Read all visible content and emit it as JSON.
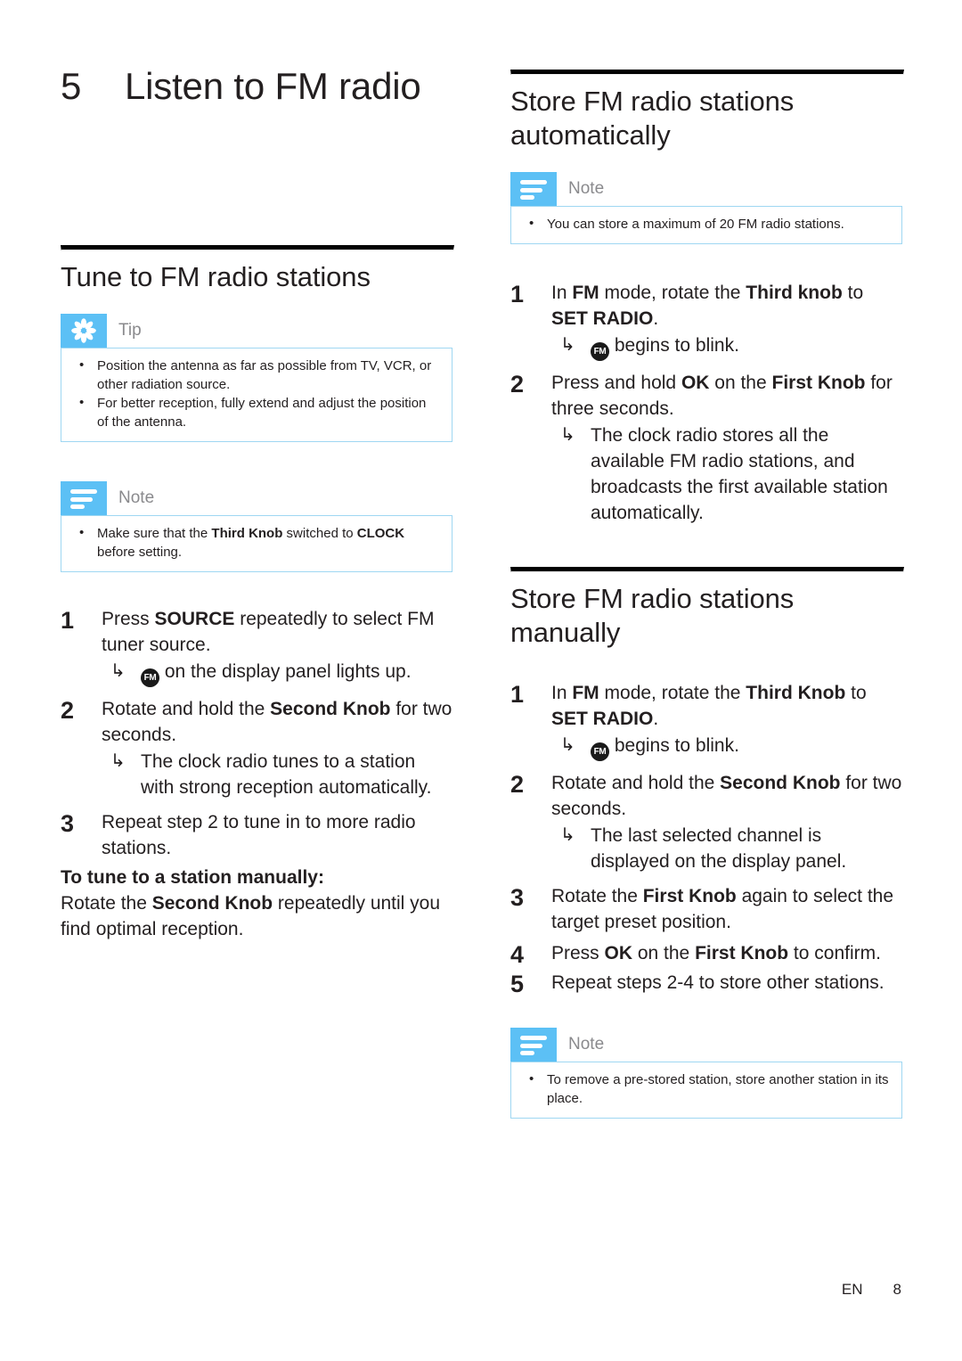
{
  "chapter": {
    "number": "5",
    "title": "Listen to FM radio"
  },
  "left_column": {
    "section_heading": "Tune to FM radio stations",
    "tip": {
      "icon": "asterisk-icon",
      "label": "Tip",
      "bullets": [
        "Position the antenna as far as possible from TV, VCR, or other radiation source.",
        "For better reception, fully extend and adjust the position of the antenna."
      ]
    },
    "note": {
      "icon": "note-lines-icon",
      "label": "Note",
      "bullet_parts": [
        "Make sure that the ",
        "Third Knob",
        " switched to ",
        "CLOCK",
        " before setting."
      ]
    },
    "steps": [
      {
        "num": "1",
        "text_parts": [
          "Press ",
          "SOURCE",
          " repeatedly to select FM tuner source."
        ],
        "substep": {
          "arrow": "↳",
          "icon": "fm-badge-icon",
          "icon_text": "FM",
          "text": " on the display panel lights up."
        }
      },
      {
        "num": "2",
        "text_parts": [
          "Rotate and hold the ",
          "Second Knob",
          " for two seconds."
        ],
        "substep": {
          "arrow": "↳",
          "text": "The clock radio tunes to a station with strong reception automatically."
        }
      },
      {
        "num": "3",
        "text_parts": [
          "Repeat step 2 to tune in to more radio stations."
        ]
      }
    ],
    "manual_tune": {
      "heading": "To tune to a station manually:",
      "body_parts": [
        "Rotate the ",
        "Second Knob",
        " repeatedly until you find optimal reception."
      ]
    }
  },
  "right_column": {
    "auto_section": {
      "heading": "Store FM radio stations automatically",
      "note": {
        "icon": "note-lines-icon",
        "label": "Note",
        "bullets": [
          "You can store a maximum of 20 FM radio stations."
        ]
      },
      "steps": [
        {
          "num": "1",
          "text_parts": [
            "In ",
            "FM",
            " mode, rotate the ",
            "Third knob",
            " to ",
            "SET RADIO",
            "."
          ],
          "substep": {
            "arrow": "↳",
            "icon": "fm-badge-icon",
            "icon_text": "FM",
            "text": " begins to blink."
          }
        },
        {
          "num": "2",
          "text_parts": [
            "Press and hold ",
            "OK",
            " on the ",
            "First Knob",
            " for three seconds."
          ],
          "substep": {
            "arrow": "↳",
            "text": "The clock radio stores all the available FM radio stations, and broadcasts the first available station automatically."
          }
        }
      ]
    },
    "manual_section": {
      "heading": "Store FM radio stations manually",
      "steps": [
        {
          "num": "1",
          "text_parts": [
            "In ",
            "FM",
            " mode, rotate the ",
            "Third Knob",
            " to ",
            "SET RADIO",
            "."
          ],
          "substep": {
            "arrow": "↳",
            "icon": "fm-badge-icon",
            "icon_text": "FM",
            "text": " begins to blink."
          }
        },
        {
          "num": "2",
          "text_parts": [
            "Rotate and hold the ",
            "Second Knob",
            " for two seconds."
          ],
          "substep": {
            "arrow": "↳",
            "text": "The last selected channel is displayed on the display panel."
          }
        },
        {
          "num": "3",
          "text_parts": [
            "Rotate the ",
            "First Knob",
            " again to select the target preset position."
          ]
        },
        {
          "num": "4",
          "text_parts": [
            "Press ",
            "OK",
            " on the ",
            "First Knob",
            " to confirm."
          ]
        },
        {
          "num": "5",
          "text_parts": [
            "Repeat steps 2-4 to store other stations."
          ]
        }
      ],
      "note": {
        "icon": "note-lines-icon",
        "label": "Note",
        "bullets": [
          "To remove a pre-stored station, store another station in its place."
        ]
      }
    }
  },
  "footer": {
    "language": "EN",
    "page_number": "8"
  },
  "colors": {
    "callout_blue": "#5cc0f5",
    "callout_border": "#9fd7f2",
    "label_gray": "#8a8a8d",
    "text_black": "#231f20"
  }
}
